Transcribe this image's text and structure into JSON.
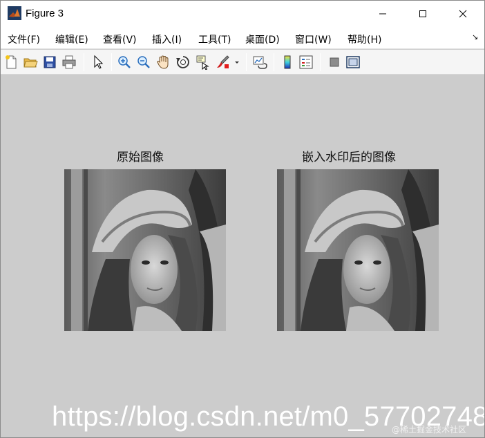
{
  "window": {
    "title": "Figure 3",
    "controls": {
      "minimize": "minimize",
      "maximize": "maximize",
      "close": "close"
    }
  },
  "menubar": {
    "items": [
      {
        "label": "文件(F)"
      },
      {
        "label": "编辑(E)"
      },
      {
        "label": "查看(V)"
      },
      {
        "label": "插入(I)"
      },
      {
        "label": "工具(T)"
      },
      {
        "label": "桌面(D)"
      },
      {
        "label": "窗口(W)"
      },
      {
        "label": "帮助(H)"
      }
    ]
  },
  "toolbar": {
    "icons": [
      "new-figure-icon",
      "open-file-icon",
      "save-icon",
      "print-icon",
      "select-pointer-icon",
      "zoom-in-icon",
      "zoom-out-icon",
      "pan-hand-icon",
      "rotate-3d-icon",
      "data-cursor-icon",
      "brush-icon",
      "brush-dropdown-icon",
      "link-plot-icon",
      "colorbar-icon",
      "legend-icon",
      "hide-plot-tools-icon",
      "show-plot-tools-icon"
    ]
  },
  "figure": {
    "left_title": "原始图像",
    "right_title": "嵌入水印后的图像"
  },
  "overlay": {
    "watermark": "https://blog.csdn.net/m0_57702748",
    "credit": "@稀土掘金技术社区"
  },
  "colors": {
    "canvas_bg": "#cccccc",
    "toolbar_bg": "#f5f5f5",
    "titlebar_bg": "#ffffff"
  }
}
